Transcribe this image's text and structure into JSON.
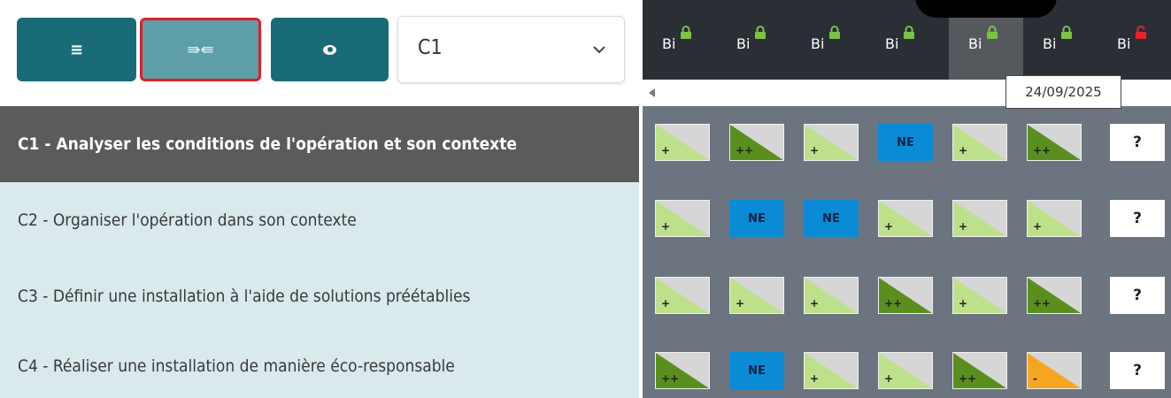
{
  "toolbar": {
    "menu_icon": "≡",
    "compress_icon": "⇛⇚",
    "view_icon": "eye-icon",
    "select_value": "C1"
  },
  "competences": [
    {
      "label": "C1 - Analyser les conditions de l'opération et son contexte",
      "selected": true
    },
    {
      "label": "C2 - Organiser l'opération dans son contexte",
      "selected": false
    },
    {
      "label": "C3 - Définir une installation à l'aide de solutions préétablies",
      "selected": false
    },
    {
      "label": "C4 - Réaliser une installation de manière éco-responsable",
      "selected": false
    }
  ],
  "tabs": [
    {
      "label": "Bi",
      "locked": true
    },
    {
      "label": "Bi",
      "locked": true
    },
    {
      "label": "Bi",
      "locked": true
    },
    {
      "label": "Bi",
      "locked": true
    },
    {
      "label": "Bi",
      "locked": true,
      "active": true
    },
    {
      "label": "Bi",
      "locked": true
    },
    {
      "label": "Bi",
      "locked": false
    }
  ],
  "tooltip_date": "24/09/2025",
  "colors": {
    "teal": "#196b78",
    "teal_light": "#5e9ea9",
    "lock_green": "#7dc242",
    "lock_red": "#e8232a",
    "level_plus": "#bfe08a",
    "level_plusplus": "#5a8f1f",
    "level_minus": "#f6a623",
    "ne_blue": "#0b8bd6"
  },
  "grid": [
    [
      "+",
      "++",
      "+",
      "NE",
      "+",
      "++",
      "?"
    ],
    [
      "+",
      "NE",
      "NE",
      "+",
      "+",
      "+",
      "?"
    ],
    [
      "+",
      "+",
      "+",
      "++",
      "+",
      "++",
      "?"
    ],
    [
      "++",
      "NE",
      "+",
      "+",
      "++",
      "-",
      "?"
    ]
  ]
}
